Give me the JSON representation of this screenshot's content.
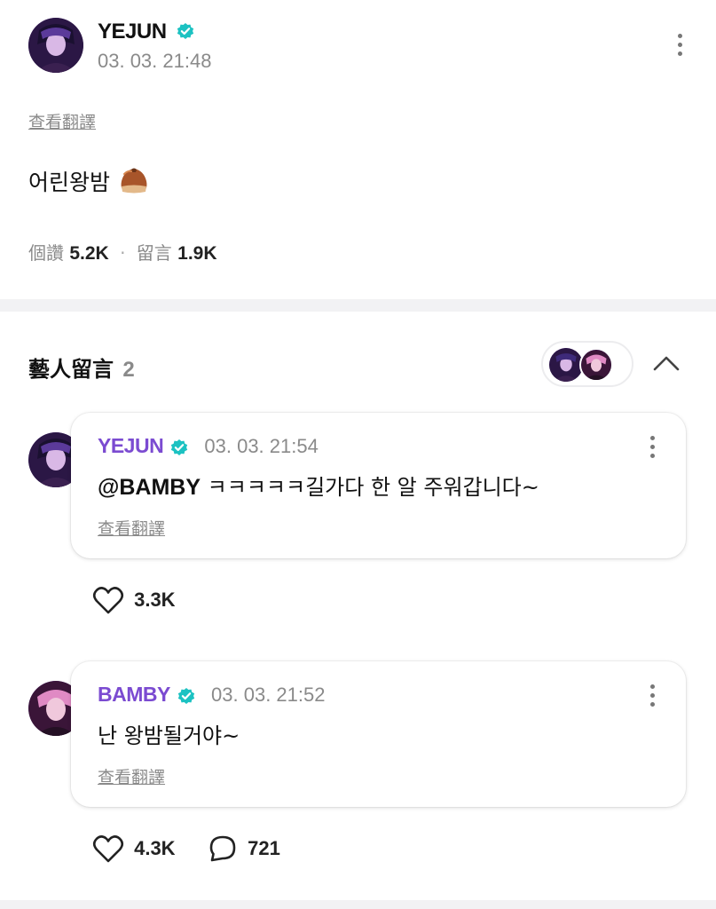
{
  "post": {
    "author": "YEJUN",
    "timestamp": "03. 03. 21:48",
    "translate_label": "查看翻譯",
    "content": "어린왕밤",
    "likes_label": "個讚",
    "likes_count": "5.2K",
    "separator": "·",
    "comments_label": "留言",
    "comments_count": "1.9K"
  },
  "artist_comments": {
    "title": "藝人留言",
    "count": "2",
    "comments": [
      {
        "author": "YEJUN",
        "timestamp": "03. 03. 21:54",
        "mention": "@BAMBY",
        "text": " ㅋㅋㅋㅋㅋ길가다 한 알 주워갑니다~",
        "translate_label": "查看翻譯",
        "likes": "3.3K"
      },
      {
        "author": "BAMBY",
        "timestamp": "03. 03. 21:52",
        "text": "난 왕밤될거야~",
        "translate_label": "查看翻譯",
        "likes": "4.3K",
        "replies": "721"
      }
    ]
  },
  "colors": {
    "accent_purple": "#7b4bd1",
    "verified_teal": "#1cc2c2",
    "divider": "#f2f2f4",
    "muted_text": "#8a8a8a"
  },
  "icons": [
    "verified-badge-icon",
    "more-options-icon",
    "chestnut-emoji-icon",
    "chevron-up-icon",
    "heart-icon",
    "comment-bubble-icon"
  ]
}
